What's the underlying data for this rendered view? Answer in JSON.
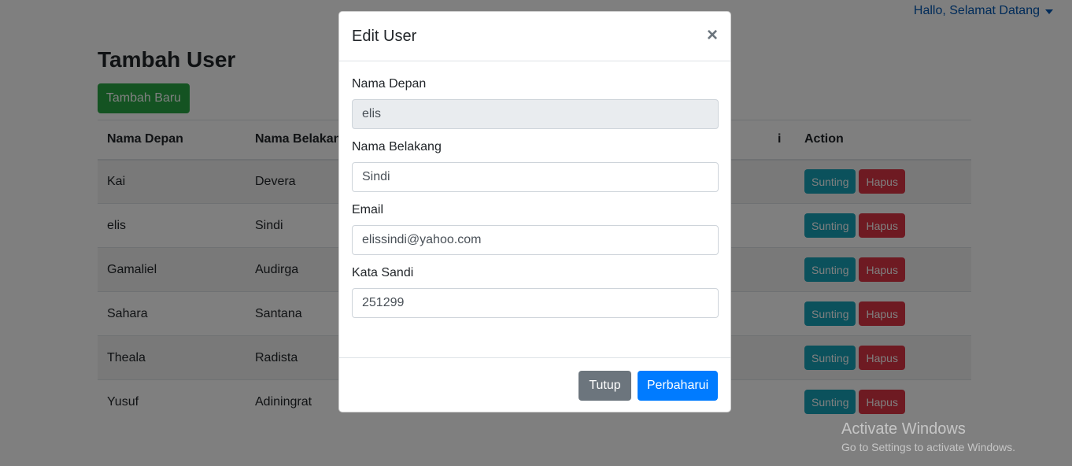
{
  "header": {
    "user_menu_label": "Hallo, Selamat Datang"
  },
  "page": {
    "title": "Tambah User",
    "add_button": "Tambah Baru"
  },
  "table": {
    "columns": [
      "Nama Depan",
      "Nama Belakang",
      "",
      "",
      "Action"
    ],
    "column4_visible_fragment": "i",
    "rows": [
      {
        "first": "Kai",
        "last": "Devera"
      },
      {
        "first": "elis",
        "last": "Sindi"
      },
      {
        "first": "Gamaliel",
        "last": "Audirga"
      },
      {
        "first": "Sahara",
        "last": "Santana"
      },
      {
        "first": "Theala",
        "last": "Radista"
      },
      {
        "first": "Yusuf",
        "last": "Adiningrat"
      }
    ],
    "edit_label": "Sunting",
    "delete_label": "Hapus"
  },
  "modal": {
    "title": "Edit User",
    "close_symbol": "×",
    "fields": [
      {
        "label": "Nama Depan",
        "value": "elis",
        "readonly": true
      },
      {
        "label": "Nama Belakang",
        "value": "Sindi",
        "readonly": false
      },
      {
        "label": "Email",
        "value": "elissindi@yahoo.com",
        "readonly": false
      },
      {
        "label": "Kata Sandi",
        "value": "251299",
        "readonly": false
      }
    ],
    "close_button": "Tutup",
    "update_button": "Perbaharui"
  },
  "watermark": {
    "title": "Activate Windows",
    "subtitle": "Go to Settings to activate Windows."
  },
  "colors": {
    "success": "#28a745",
    "info": "#17a2b8",
    "danger": "#dc3545",
    "primary": "#007bff",
    "secondary": "#6c757d",
    "link": "#0056b3"
  }
}
